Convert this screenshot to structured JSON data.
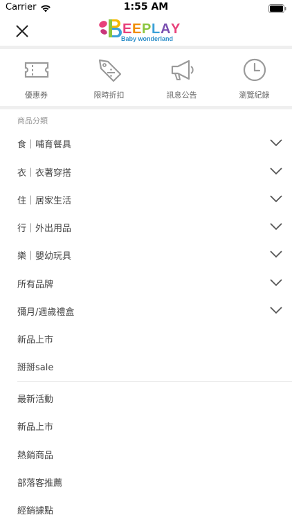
{
  "status": {
    "carrier": "Carrier",
    "time": "1:55 AM"
  },
  "header": {
    "brand": "EEPLAY",
    "tagline": "Baby wonderland"
  },
  "quick_links": [
    {
      "label": "優惠券",
      "icon": "ticket-icon"
    },
    {
      "label": "限時折扣",
      "icon": "discount-tag-icon"
    },
    {
      "label": "訊息公告",
      "icon": "megaphone-icon"
    },
    {
      "label": "瀏覽紀錄",
      "icon": "clock-icon"
    }
  ],
  "categories": {
    "title": "商品分類",
    "items": [
      {
        "label": "食｜哺育餐具",
        "expandable": true
      },
      {
        "label": "衣｜衣著穿搭",
        "expandable": true
      },
      {
        "label": "住｜居家生活",
        "expandable": true
      },
      {
        "label": "行｜外出用品",
        "expandable": true
      },
      {
        "label": "樂｜嬰幼玩具",
        "expandable": true
      },
      {
        "label": "所有品牌",
        "expandable": true
      },
      {
        "label": "彌月/週歲禮盒",
        "expandable": true
      },
      {
        "label": "新品上市",
        "expandable": false
      },
      {
        "label": "掰掰sale",
        "expandable": false
      }
    ]
  },
  "links": {
    "items": [
      {
        "label": "最新活動"
      },
      {
        "label": "新品上市"
      },
      {
        "label": "熱銷商品"
      },
      {
        "label": "部落客推薦"
      },
      {
        "label": "經銷據點"
      }
    ]
  }
}
